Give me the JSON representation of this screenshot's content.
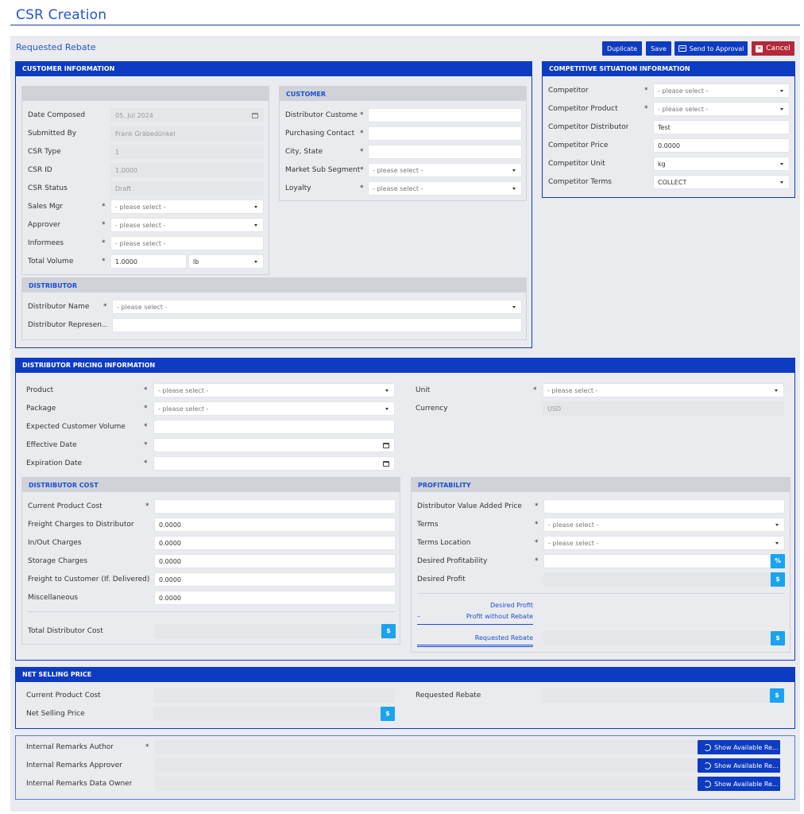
{
  "app": {
    "title": "CSR Creation",
    "subtitle": "Requested Rebate"
  },
  "toolbar": {
    "duplicate": "Duplicate",
    "save": "Save",
    "send": "Send to Approval",
    "cancel": "Cancel"
  },
  "customer_info": {
    "header": "CUSTOMER INFORMATION",
    "left": {
      "date_composed": {
        "label": "Date Composed",
        "value": "05. Jul 2024"
      },
      "submitted_by": {
        "label": "Submitted By",
        "value": "Frank Gräbedünkel"
      },
      "csr_type": {
        "label": "CSR Type",
        "value": "1"
      },
      "csr_id": {
        "label": "CSR ID",
        "value": "1.0000"
      },
      "csr_status": {
        "label": "CSR Status",
        "value": "Draft"
      },
      "sales_mgr": {
        "label": "Sales Mgr",
        "value": "- please select -"
      },
      "approver": {
        "label": "Approver",
        "value": "- please select -"
      },
      "informees": {
        "label": "Informees",
        "value": "- please select -"
      },
      "total_volume": {
        "label": "Total Volume",
        "value": "1.0000",
        "unit": "lb"
      }
    },
    "customer": {
      "header": "CUSTOMER",
      "distributor_customer": {
        "label": "Distributor Custome...",
        "value": ""
      },
      "purchasing_contact": {
        "label": "Purchasing Contact",
        "value": ""
      },
      "city_state": {
        "label": "City, State",
        "value": ""
      },
      "market_sub_segment": {
        "label": "Market Sub Segment",
        "value": "- please select -"
      },
      "loyalty": {
        "label": "Loyalty",
        "value": "- please select -"
      }
    },
    "distributor": {
      "header": "DISTRIBUTOR",
      "name": {
        "label": "Distributor Name",
        "value": "- please select -"
      },
      "representative": {
        "label": "Distributor Represen...",
        "value": ""
      }
    }
  },
  "competitive": {
    "header": "COMPETITIVE SITUATION INFORMATION",
    "competitor": {
      "label": "Competitor",
      "value": "- please select -"
    },
    "competitor_product": {
      "label": "Competitor Product",
      "value": "- please select -"
    },
    "competitor_distributor": {
      "label": "Competitor Distributor",
      "value": "Test"
    },
    "competitor_price": {
      "label": "Competitor Price",
      "value": "0.0000"
    },
    "competitor_unit": {
      "label": "Competitor Unit",
      "value": "kg"
    },
    "competitor_terms": {
      "label": "Competitor Terms",
      "value": "COLLECT"
    }
  },
  "pricing": {
    "header": "DISTRIBUTOR PRICING INFORMATION",
    "product": {
      "label": "Product",
      "value": "- please select -"
    },
    "package": {
      "label": "Package",
      "value": "- please select -"
    },
    "expected_volume": {
      "label": "Expected Customer Volume",
      "value": ""
    },
    "effective_date": {
      "label": "Effective Date",
      "value": ""
    },
    "expiration_date": {
      "label": "Expiration Date",
      "value": ""
    },
    "unit": {
      "label": "Unit",
      "value": "- please select -"
    },
    "currency": {
      "label": "Currency",
      "value": "USD"
    },
    "cost": {
      "header": "DISTRIBUTOR COST",
      "current_product_cost": {
        "label": "Current Product Cost",
        "value": ""
      },
      "freight_to_distributor": {
        "label": "Freight Charges to Distributor",
        "value": "0.0000"
      },
      "in_out": {
        "label": "In/Out Charges",
        "value": "0.0000"
      },
      "storage": {
        "label": "Storage Charges",
        "value": "0.0000"
      },
      "freight_to_customer": {
        "label": "Freight to Customer (If. Delivered)",
        "value": "0.0000"
      },
      "misc": {
        "label": "Miscellaneous",
        "value": "0.0000"
      },
      "total": {
        "label": "Total Distributor Cost",
        "value": ""
      }
    },
    "profitability": {
      "header": "PROFITABILITY",
      "value_added_price": {
        "label": "Distributor Value Added Price",
        "value": ""
      },
      "terms": {
        "label": "Terms",
        "value": "- please select -"
      },
      "terms_location": {
        "label": "Terms Location",
        "value": "- please select -"
      },
      "desired_profitability": {
        "label": "Desired Profitability",
        "value": ""
      },
      "desired_profit": {
        "label": "Desired Profit",
        "value": ""
      },
      "calc_line1": "Desired Profit",
      "calc_minus": "–",
      "calc_line2": "Profit without Rebate",
      "requested_rebate": {
        "label": "Requested Rebate",
        "value": ""
      }
    }
  },
  "net": {
    "header": "NET SELLING PRICE",
    "current_product_cost": {
      "label": "Current Product Cost",
      "value": ""
    },
    "net_selling_price": {
      "label": "Net Selling Price",
      "value": ""
    },
    "requested_rebate": {
      "label": "Requested Rebate",
      "value": ""
    }
  },
  "remarks": {
    "author": {
      "label": "Internal Remarks Author",
      "value": ""
    },
    "approver": {
      "label": "Internal Remarks Approver",
      "value": ""
    },
    "data_owner": {
      "label": "Internal Remarks Data Owner",
      "value": ""
    },
    "show_label": "Show Available Re..."
  },
  "symbols": {
    "required": "*",
    "dollar": "$",
    "percent": "%"
  },
  "icons": {
    "calendar": "calendar-icon",
    "caret": "chevron-down-icon",
    "history": "history-icon",
    "envelope": "envelope-icon",
    "close": "close-icon"
  },
  "colors": {
    "primary": "#0d3bc2",
    "accent": "#1aa3ef",
    "danger": "#b3283a",
    "background": "#e9ebee",
    "title": "#2255cc"
  }
}
